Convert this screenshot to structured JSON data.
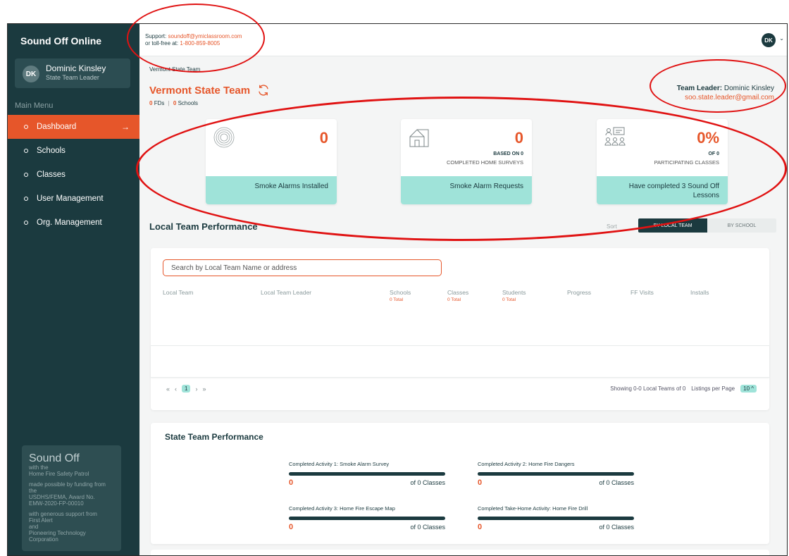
{
  "sidebar": {
    "brand": "Sound Off Online",
    "user": {
      "initials": "DK",
      "name": "Dominic Kinsley",
      "role": "State Team Leader"
    },
    "menu_heading": "Main Menu",
    "items": [
      {
        "label": "Dashboard",
        "active": true,
        "arrow": "→"
      },
      {
        "label": "Schools"
      },
      {
        "label": "Classes"
      },
      {
        "label": "User Management"
      },
      {
        "label": "Org. Management"
      }
    ],
    "footer": {
      "title": "Sound Off",
      "sub1": "with the",
      "sub2": "Home Fire Safety Patrol",
      "fund1": "made possible by funding from the",
      "fund2": "USDHS/FEMA, Award No.",
      "fund3": "EMW-2020-FP-00010",
      "supp1": "with generous support from",
      "supp2": "First Alert",
      "supp3": "and",
      "supp4": "Pioneering Technology",
      "supp5": "Corporation"
    }
  },
  "topbar": {
    "support_label": "Support:",
    "support_email": "soundoff@ymiclassroom.com",
    "tollfree_label": "or toll-free at:",
    "tollfree_number": "1-800-859-8005",
    "avatar": "DK",
    "caret": "⌄"
  },
  "header": {
    "breadcrumb": "Vermont State Team",
    "title": "Vermont State Team",
    "fds_count": "0",
    "fds_label": "FDs",
    "schools_count": "0",
    "schools_label": "Schools",
    "leader_label": "Team Leader:",
    "leader_name": "Dominic Kinsley",
    "leader_email": "soo.state.leader@gmail.com"
  },
  "stats": [
    {
      "icon": "smoke-alarm-icon",
      "value": "0",
      "sub1": "",
      "sub2": "",
      "band": "Smoke Alarms Installed"
    },
    {
      "icon": "house-icon",
      "value": "0",
      "sub1": "BASED ON 0",
      "sub2": "COMPLETED HOME SURVEYS",
      "band": "Smoke Alarm Requests"
    },
    {
      "icon": "classroom-icon",
      "value": "0%",
      "sub1": "OF 0",
      "sub2": "PARTICIPATING CLASSES",
      "band": "Have completed 3 Sound Off Lessons"
    }
  ],
  "local": {
    "title": "Local Team Performance",
    "sort_label": "Sort",
    "sort_options": [
      "BY LOCAL TEAM",
      "BY SCHOOL"
    ],
    "search_placeholder": "Search by Local Team Name or address",
    "columns": [
      {
        "label": "Local Team",
        "total": ""
      },
      {
        "label": "Local Team Leader",
        "total": ""
      },
      {
        "label": "Schools",
        "total": "0 Total"
      },
      {
        "label": "Classes",
        "total": "0 Total"
      },
      {
        "label": "Students",
        "total": "0 Total"
      },
      {
        "label": "Progress",
        "total": ""
      },
      {
        "label": "FF Visits",
        "total": ""
      },
      {
        "label": "Installs",
        "total": ""
      }
    ],
    "pager": {
      "first": "«",
      "prev": "‹",
      "page": "1",
      "next": "›",
      "last": "»"
    },
    "showing": "Showing 0-0 Local Teams of 0",
    "per_page_label": "Listings per Page",
    "per_page": "10 ^"
  },
  "state": {
    "title": "State Team Performance",
    "activities": [
      {
        "label": "Completed Activity 1: Smoke Alarm Survey",
        "value": "0",
        "of": "of 0 Classes"
      },
      {
        "label": "Completed Activity 2: Home Fire Dangers",
        "value": "0",
        "of": "of 0 Classes"
      },
      {
        "label": "Completed Activity 3: Home Fire Escape Map",
        "value": "0",
        "of": "of 0 Classes"
      },
      {
        "label": "Completed Take-Home Activity: Home Fire Drill",
        "value": "0",
        "of": "of 0 Classes"
      }
    ]
  },
  "colors": {
    "accent": "#e6562a",
    "sidebar": "#1b3a3f",
    "mint": "#9fe3d9",
    "annotation": "#e01212"
  }
}
